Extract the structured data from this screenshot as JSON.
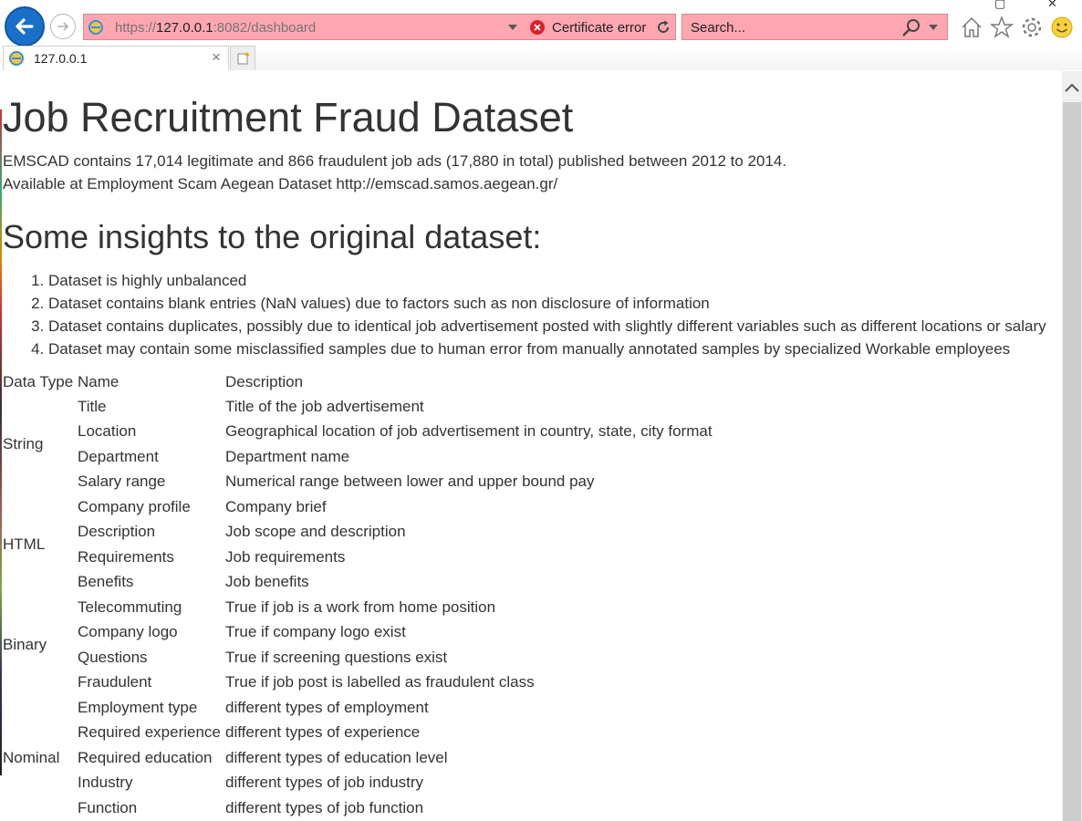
{
  "browser": {
    "address": {
      "scheme": "https://",
      "host": "127.0.0.1",
      "path": ":8082/dashboard",
      "certificate_error": "Certificate error"
    },
    "search": {
      "placeholder": "Search..."
    },
    "tabs": [
      {
        "label": "127.0.0.1"
      }
    ],
    "colors": {
      "address_error_bg": "#ffa7b1",
      "back_button": "#1a6fc9"
    }
  },
  "page": {
    "title": "Job Recruitment Fraud Dataset",
    "intro_1": "EMSCAD contains 17,014 legitimate and 866 fraudulent job ads (17,880 in total) published between 2012 to 2014.",
    "intro_2": "Available at Employment Scam Aegean Dataset http://emscad.samos.aegean.gr/",
    "insights_heading": "Some insights to the original dataset:",
    "insights": [
      "Dataset is highly unbalanced",
      "Dataset contains blank entries (NaN values) due to factors such as non disclosure of information",
      "Dataset contains duplicates, possibly due to identical job advertisement posted with slightly different variables such as different locations or salary",
      "Dataset may contain some misclassified samples due to human error from manually annotated samples by specialized Workable employees"
    ],
    "table": {
      "headers": [
        "Data Type",
        "Name",
        "Description"
      ],
      "groups": [
        {
          "type": "String",
          "rows": [
            {
              "name": "Title",
              "description": "Title of the job advertisement"
            },
            {
              "name": "Location",
              "description": "Geographical location of job advertisement in country, state, city format"
            },
            {
              "name": "Department",
              "description": "Department name"
            },
            {
              "name": "Salary range",
              "description": "Numerical range between lower and upper bound pay"
            }
          ]
        },
        {
          "type": "HTML",
          "rows": [
            {
              "name": "Company profile",
              "description": "Company brief"
            },
            {
              "name": "Description",
              "description": "Job scope and description"
            },
            {
              "name": "Requirements",
              "description": "Job requirements"
            },
            {
              "name": "Benefits",
              "description": "Job benefits"
            }
          ]
        },
        {
          "type": "Binary",
          "rows": [
            {
              "name": "Telecommuting",
              "description": "True if job is a work from home position"
            },
            {
              "name": "Company logo",
              "description": "True if company logo exist"
            },
            {
              "name": "Questions",
              "description": "True if screening questions exist"
            },
            {
              "name": "Fraudulent",
              "description": "True if job post is labelled as fraudulent class"
            }
          ]
        },
        {
          "type": "Nominal",
          "rows": [
            {
              "name": "Employment type",
              "description": "different types of employment"
            },
            {
              "name": "Required experience",
              "description": "different types of experience"
            },
            {
              "name": "Required education",
              "description": "different types of education level"
            },
            {
              "name": "Industry",
              "description": "different types of job industry"
            },
            {
              "name": "Function",
              "description": "different types of job function"
            }
          ]
        }
      ]
    }
  }
}
